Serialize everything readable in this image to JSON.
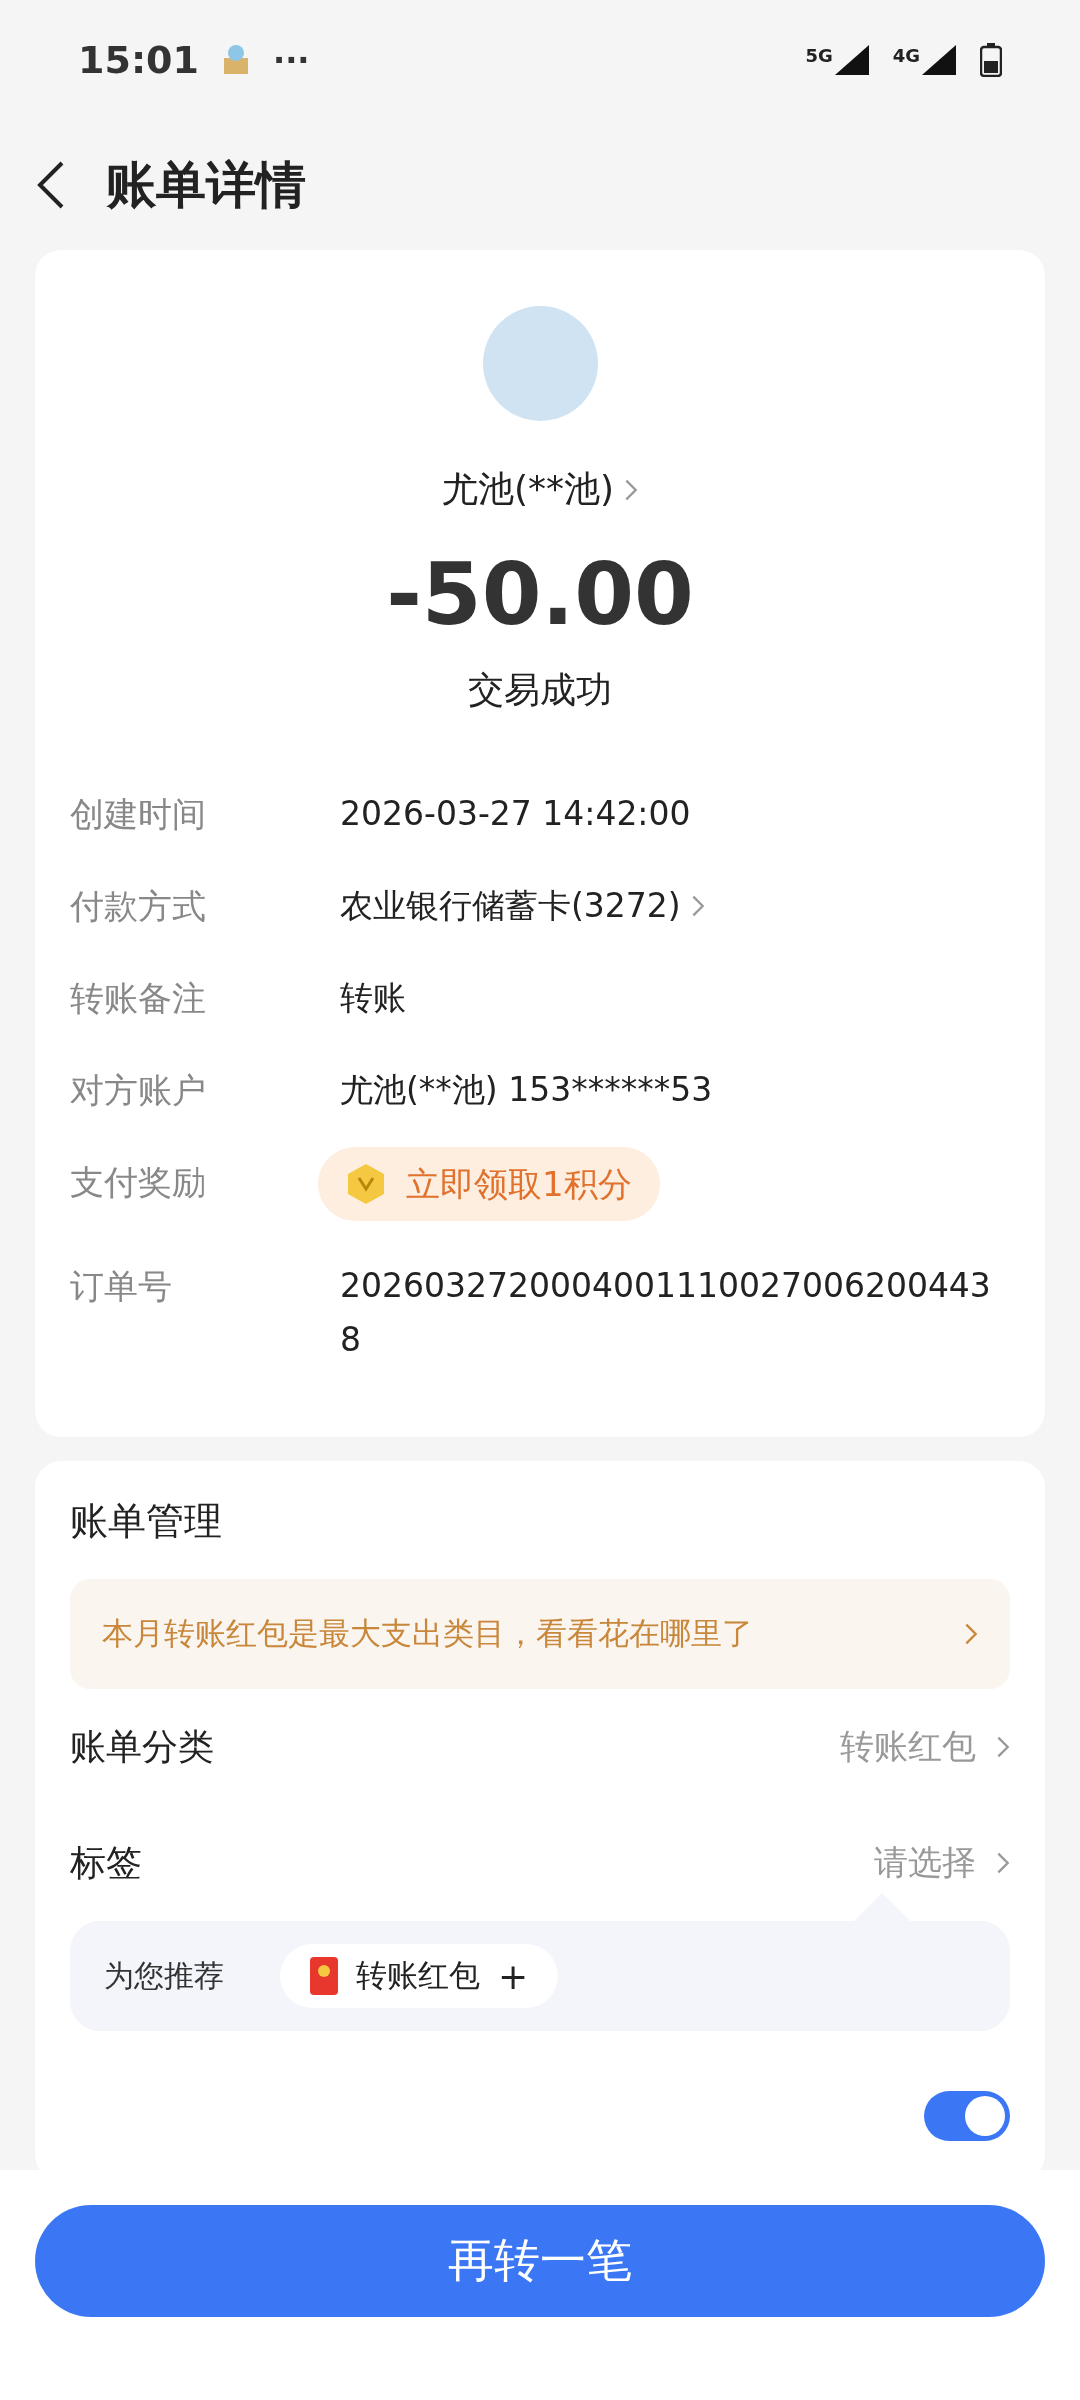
{
  "status_bar": {
    "time": "15:01",
    "more": "···",
    "network_1": "5G",
    "network_2": "4G"
  },
  "header": {
    "title": "账单详情"
  },
  "summary": {
    "counterparty": "尤池(**池)",
    "amount": "-50.00",
    "status": "交易成功"
  },
  "details": [
    {
      "kind": "text",
      "label": "创建时间",
      "value": "2026-03-27 14:42:00"
    },
    {
      "kind": "link",
      "label": "付款方式",
      "value": "农业银行储蓄卡(3272)"
    },
    {
      "kind": "text",
      "label": "转账备注",
      "value": "转账"
    },
    {
      "kind": "text",
      "label": "对方账户",
      "value": "尤池(**池) 153******53"
    },
    {
      "kind": "reward",
      "label": "支付奖励",
      "value": "立即领取1积分"
    },
    {
      "kind": "text",
      "label": "订单号",
      "value": "20260327200040011100270062004438"
    }
  ],
  "management": {
    "title": "账单管理",
    "banner": "本月转账红包是最大支出类目，看看花在哪里了",
    "rows": [
      {
        "label": "账单分类",
        "value": "转账红包"
      },
      {
        "label": "标签",
        "value": "请选择"
      }
    ],
    "recommend": {
      "label": "为您推荐",
      "tag": "转账红包",
      "add": "+"
    },
    "toggle": {
      "on": true
    }
  },
  "footer": {
    "button": "再转一笔"
  }
}
